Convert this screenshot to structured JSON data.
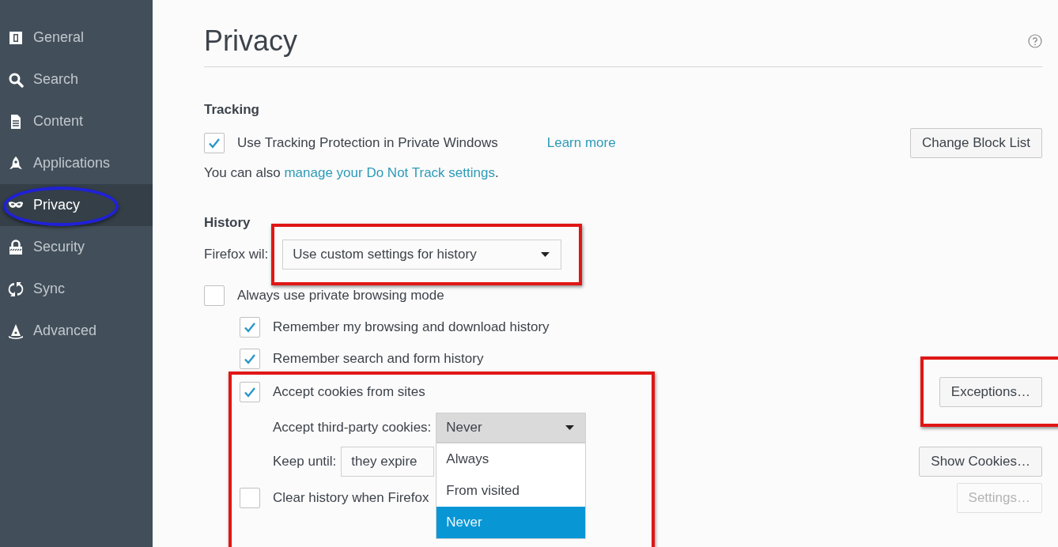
{
  "sidebar": {
    "items": [
      {
        "label": "General",
        "selected": false,
        "circled": false
      },
      {
        "label": "Search",
        "selected": false,
        "circled": false
      },
      {
        "label": "Content",
        "selected": false,
        "circled": false
      },
      {
        "label": "Applications",
        "selected": false,
        "circled": false
      },
      {
        "label": "Privacy",
        "selected": true,
        "circled": true
      },
      {
        "label": "Security",
        "selected": false,
        "circled": false
      },
      {
        "label": "Sync",
        "selected": false,
        "circled": false
      },
      {
        "label": "Advanced",
        "selected": false,
        "circled": false
      }
    ]
  },
  "page": {
    "title": "Privacy"
  },
  "tracking": {
    "heading": "Tracking",
    "protection": {
      "label": "Use Tracking Protection in Private Windows",
      "checked": true
    },
    "learn_more": "Learn more",
    "change_button": "Change Block List",
    "note": {
      "prefix": "You can also ",
      "link": "manage your Do Not Track settings",
      "suffix": "."
    }
  },
  "history": {
    "heading": "History",
    "mode_label": "Firefox wil:",
    "mode_value": "Use custom settings for history",
    "mode_annotated": true,
    "private_mode": {
      "label": "Always use private browsing mode",
      "checked": false
    },
    "options": [
      {
        "label": "Remember my browsing and download history",
        "checked": true
      },
      {
        "label": "Remember search and form history",
        "checked": true
      }
    ],
    "cookies": {
      "label": "Accept cookies from sites",
      "checked": true,
      "annotated": true,
      "exceptions_button": "Exceptions…",
      "exceptions_annotated": true,
      "third_party_label": "Accept third-party cookies:",
      "third_party_value": "Never",
      "third_party_expanded": true,
      "third_party_options": [
        {
          "label": "Always",
          "selected": false
        },
        {
          "label": "From visited",
          "selected": false
        },
        {
          "label": "Never",
          "selected": true
        }
      ],
      "keep_label": "Keep until:",
      "keep_value": "they expire",
      "show_cookies_button": "Show Cookies…"
    },
    "clear_on_close": {
      "label": "Clear history when Firefox",
      "checked": false
    },
    "settings_button": {
      "label": "Settings…",
      "disabled": true
    }
  }
}
